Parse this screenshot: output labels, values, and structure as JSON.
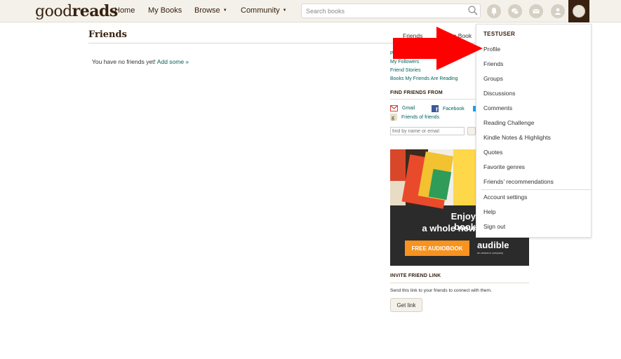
{
  "header": {
    "logo_bold": "good",
    "logo_light": "reads",
    "nav": [
      "Home",
      "My Books",
      "Browse",
      "Community"
    ],
    "nav_caret": "▼",
    "search_placeholder": "Search books",
    "icons": [
      "search-icon",
      "notifications-icon",
      "discussions-icon",
      "messages-icon",
      "friends-icon"
    ]
  },
  "main": {
    "title": "Friends",
    "tabs": [
      "Friends",
      "Update Book"
    ],
    "empty_message": "You have no friends yet!",
    "add_link": "Add some »"
  },
  "sidebar": {
    "links": [
      "People I'm Following",
      "My Followers",
      "Friend Stories",
      "Books My Friends Are Reading"
    ],
    "find_heading": "FIND FRIENDS FROM",
    "sources": [
      "Gmail",
      "Facebook",
      "Friends of friends"
    ],
    "find_placeholder": "find by name or email",
    "ad": {
      "headline_1": "Enjoy book",
      "headline_2": "a whole new",
      "cta": "FREE AUDIOBOOK",
      "brand": "audible",
      "brand_sub": "an amazon company"
    },
    "invite_heading": "INVITE FRIEND LINK",
    "invite_text": "Send this link to your friends to connect with them.",
    "get_link": "Get link"
  },
  "dropdown": {
    "username": "TESTUSER",
    "items": [
      "Profile",
      "Friends",
      "Groups",
      "Discussions",
      "Comments",
      "Reading Challenge",
      "Kindle Notes & Highlights",
      "Quotes",
      "Favorite genres",
      "Friends’ recommendations"
    ],
    "account_items": [
      "Account settings",
      "Help",
      "Sign out"
    ]
  },
  "colors": {
    "brand_brown": "#382110",
    "header_bg": "#f4f1ea",
    "link_green": "#00635d",
    "annotation_arrow": "#ff0000",
    "ad_orange": "#f7931e"
  }
}
